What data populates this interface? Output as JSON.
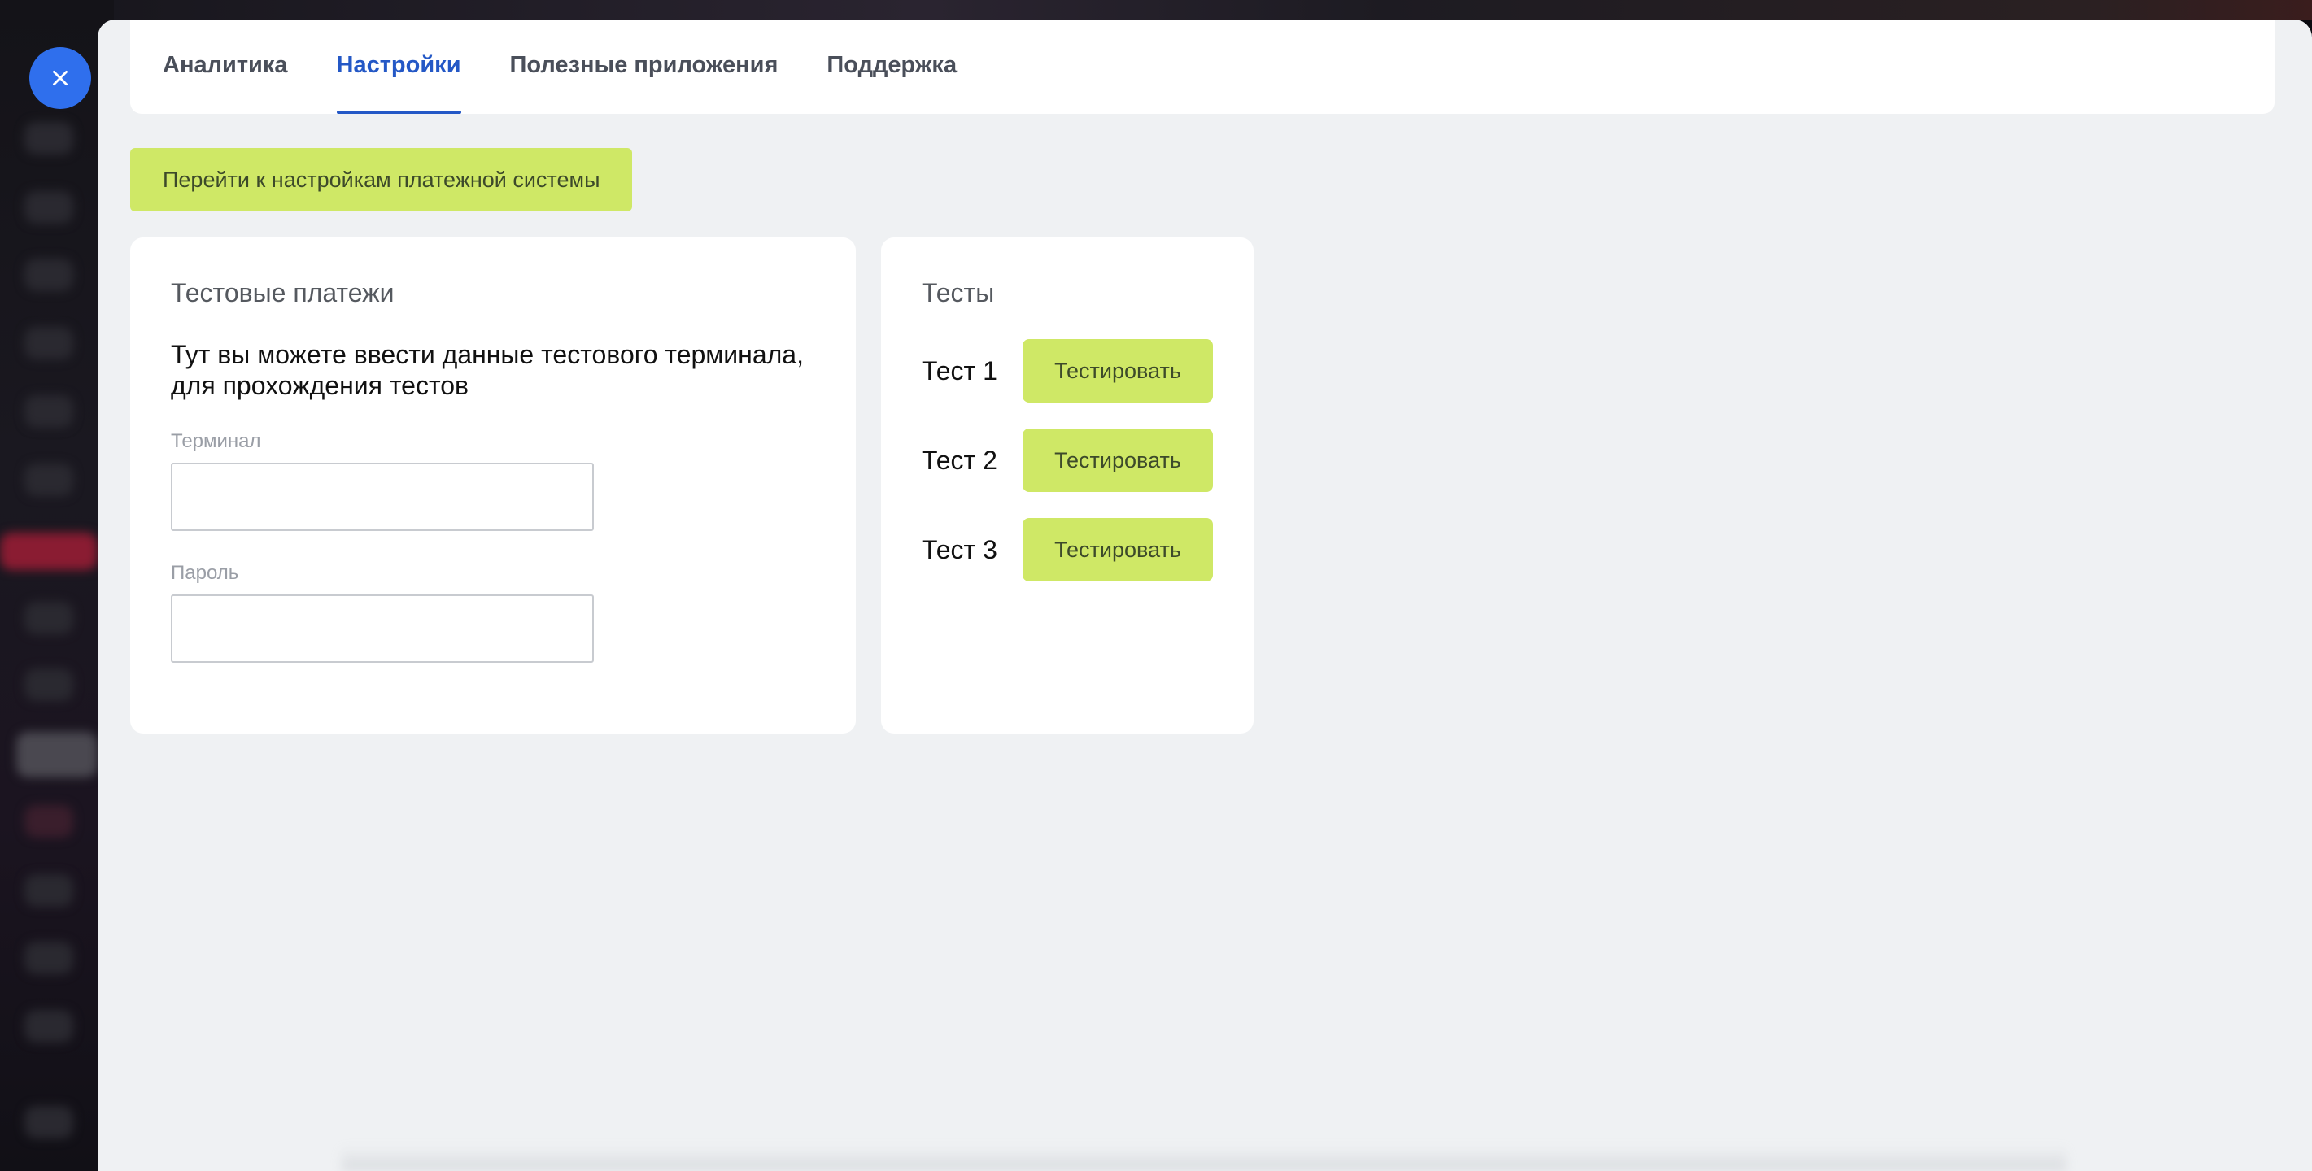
{
  "colors": {
    "accent": "#2458c6",
    "button_bg": "#cfe866",
    "close_button": "#2f6fed",
    "panel_bg": "#eff1f3"
  },
  "close_button": {
    "icon": "close-icon"
  },
  "tabs": [
    {
      "label": "Аналитика",
      "active": false
    },
    {
      "label": "Настройки",
      "active": true
    },
    {
      "label": "Полезные приложения",
      "active": false
    },
    {
      "label": "Поддержка",
      "active": false
    }
  ],
  "payment_settings_button": {
    "label": "Перейти к настройкам платежной системы"
  },
  "test_payments": {
    "title": "Тестовые платежи",
    "description": "Тут вы можете ввести данные тестового терминала, для прохождения тестов",
    "terminal": {
      "label": "Терминал",
      "value": ""
    },
    "password": {
      "label": "Пароль",
      "value": ""
    }
  },
  "tests": {
    "title": "Тесты",
    "items": [
      {
        "label": "Тест 1",
        "button": "Тестировать"
      },
      {
        "label": "Тест 2",
        "button": "Тестировать"
      },
      {
        "label": "Тест 3",
        "button": "Тестировать"
      }
    ]
  }
}
